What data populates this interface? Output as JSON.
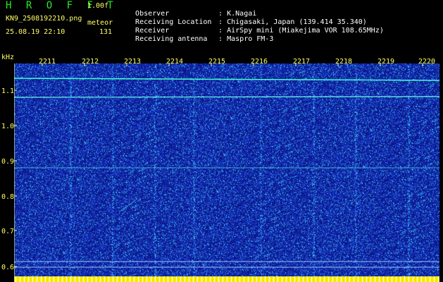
{
  "header": {
    "app_title": "H R O F F T",
    "version": "1.00f",
    "filename": "KN9_2508192210.png",
    "timestamp": "25.08.19 22:10",
    "meteor_label": "meteor",
    "meteor_count": "131"
  },
  "station": {
    "observer_label": "Observer",
    "observer_value": "K.Nagai",
    "location_label": "Receiving Location",
    "location_value": "Chigasaki, Japan (139.414 35.340)",
    "receiver_label": "Receiver",
    "receiver_value": "AirSpy mini (Miakejima VOR 108.65MHz)",
    "antenna_label": "Receiving antenna",
    "antenna_value": "Maspro FM-3",
    "separator": ":"
  },
  "chart_data": {
    "type": "heatmap",
    "ylabel": "kHz",
    "y_ticks": [
      "1.1",
      "1.0",
      "0.9",
      "0.8",
      "0.7",
      "0.6"
    ],
    "x_ticks": [
      "2211",
      "2212",
      "2213",
      "2214",
      "2215",
      "2216",
      "2217",
      "2218",
      "2219",
      "2220"
    ],
    "ylim": [
      0.6,
      1.15
    ],
    "colors": {
      "background": "#1a2ab8",
      "noise_dark": "#0a1580",
      "noise_bright": "#40c0ff",
      "signal": "#44ffcc",
      "axis_text": "#ffff66"
    }
  }
}
